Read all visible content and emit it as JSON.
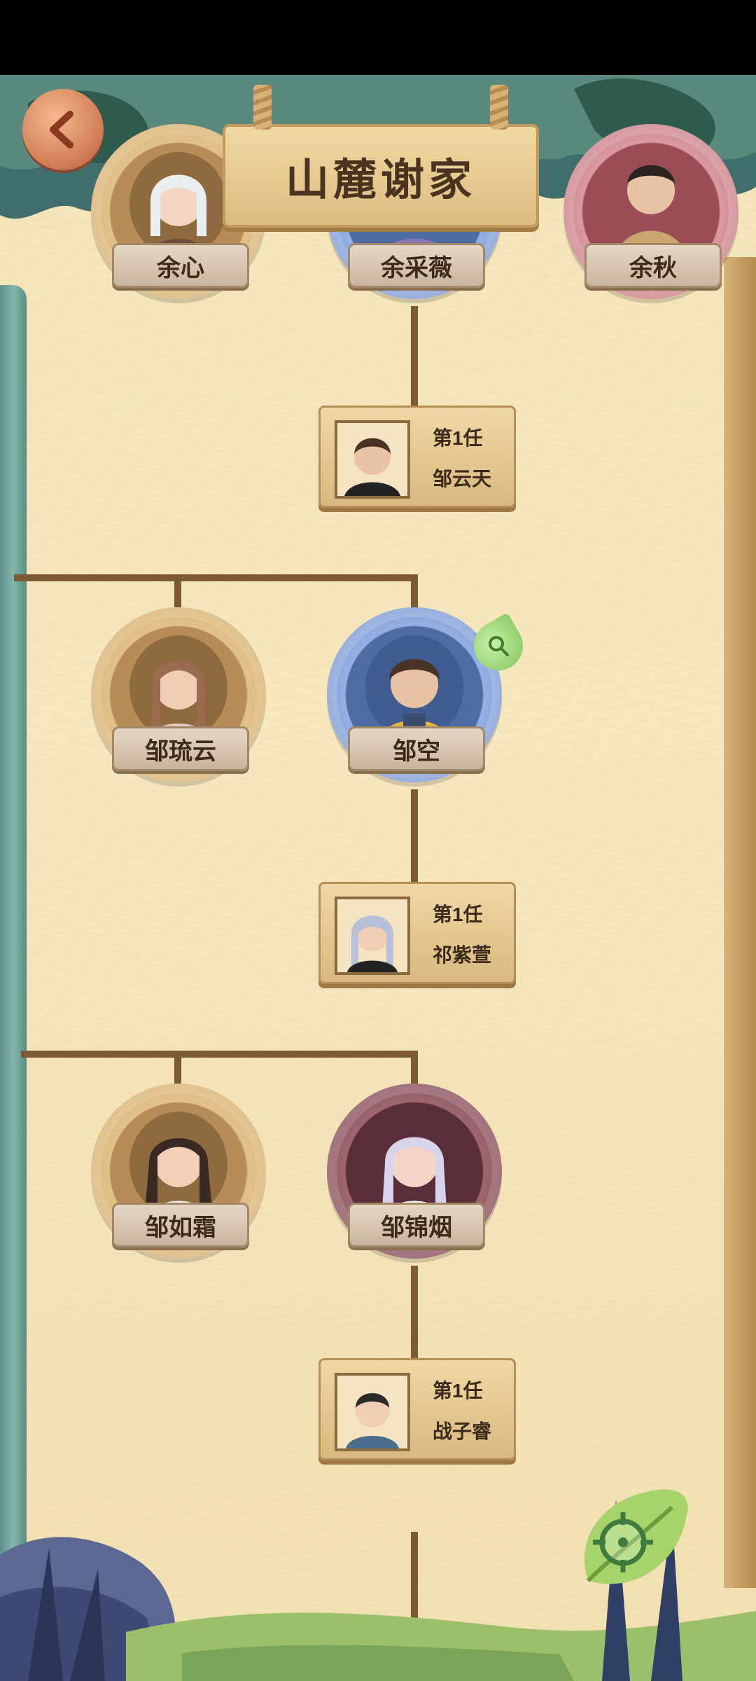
{
  "header": {
    "title": "山麓谢家"
  },
  "top_row": [
    {
      "name": "余心",
      "ring": "tan"
    },
    {
      "name": "余采薇",
      "ring": "blue"
    },
    {
      "name": "余秋",
      "ring": "pink"
    }
  ],
  "gen1_spouse": {
    "order": "第1任",
    "name": "邹云天"
  },
  "gen2": [
    {
      "name": "邹琉云",
      "ring": "tan"
    },
    {
      "name": "邹空",
      "ring": "blue"
    }
  ],
  "gen2_spouse": {
    "order": "第1任",
    "name": "祁紫萱"
  },
  "gen3": [
    {
      "name": "邹如霜",
      "ring": "tan"
    },
    {
      "name": "邹锦烟",
      "ring": "maroon"
    }
  ],
  "gen3_spouse": {
    "order": "第1任",
    "name": "战子睿"
  },
  "icons": {
    "back": "back-arrow-icon",
    "locate": "crosshair-icon",
    "search_leaf": "magnifier-leaf-icon"
  }
}
